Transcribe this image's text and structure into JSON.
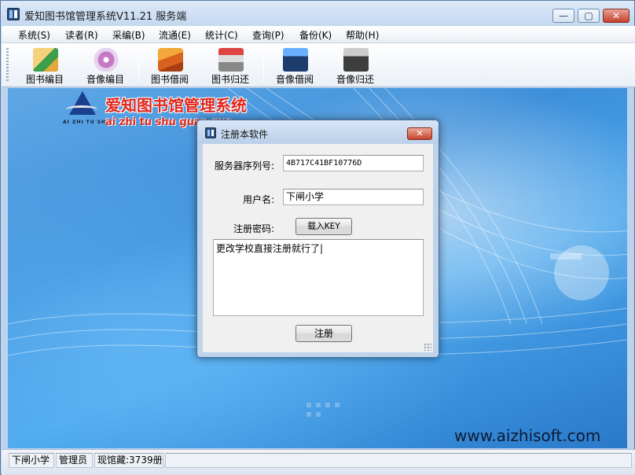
{
  "window": {
    "title": "爱知图书馆管理系统V11.21 服务端",
    "controls": {
      "minimize": "—",
      "maximize": "▢",
      "close": "✕"
    }
  },
  "menu": [
    {
      "label": "系统(S)"
    },
    {
      "label": "读者(R)"
    },
    {
      "label": "采编(B)"
    },
    {
      "label": "流通(E)"
    },
    {
      "label": "统计(C)"
    },
    {
      "label": "查询(P)"
    },
    {
      "label": "备份(K)"
    },
    {
      "label": "帮助(H)"
    }
  ],
  "toolbar": [
    {
      "label": "图书编目",
      "icon": "book-catalog-icon"
    },
    {
      "label": "音像编目",
      "icon": "audio-catalog-icon"
    },
    {
      "label": "图书借阅",
      "icon": "book-lend-icon"
    },
    {
      "label": "图书归还",
      "icon": "book-return-icon"
    },
    {
      "label": "音像借阅",
      "icon": "audio-lend-icon"
    },
    {
      "label": "音像归还",
      "icon": "audio-return-icon"
    }
  ],
  "banner": {
    "logo_small": "AI ZHI TU SHU",
    "title_cn": "爱知图书馆管理系统",
    "title_pinyin": "ai zhi tu shu guan gua",
    "watermark": "www.aizhisoft.com"
  },
  "dialog": {
    "title": "注册本软件",
    "close": "✕",
    "serial_label": "服务器序列号:",
    "serial_value": "4B717C41BF10776D",
    "user_label": "用户名:",
    "user_value": "下闸小学",
    "key_label": "注册密码:",
    "load_key_button": "载入KEY",
    "memo_text": "更改学校直接注册就行了|",
    "register_button": "注册"
  },
  "status": {
    "school": "下闸小学",
    "role": "管理员",
    "holdings": "现馆藏:3739册"
  }
}
